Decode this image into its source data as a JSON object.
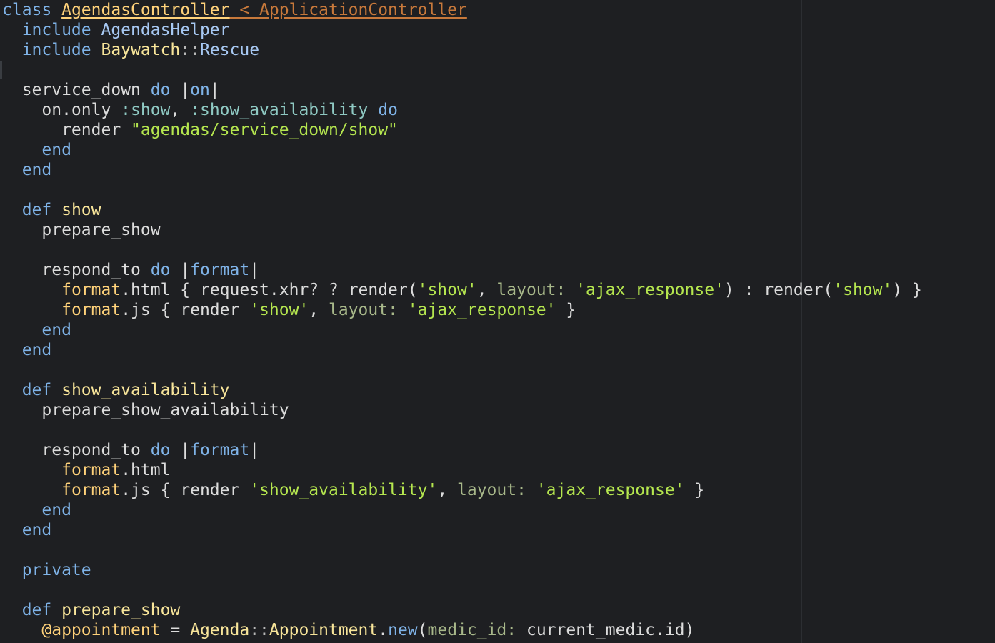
{
  "editor": {
    "colors": {
      "background": "#1e1f22",
      "keyword": "#7fb3e8",
      "class_name": "#ffd27a",
      "superclass": "#c8793b",
      "module": "#a7c8f2",
      "constant": "#f8e59a",
      "string": "#b5e64f",
      "symbol": "#8fc9c3",
      "method_def": "#f8e59a",
      "hash_key": "#a8b88a",
      "plain": "#dcdcdc"
    },
    "lines": [
      [
        {
          "t": "class ",
          "c": "kw"
        },
        {
          "t": "AgendasController",
          "c": "cls"
        },
        {
          "t": " < ApplicationController",
          "c": "sup"
        }
      ],
      [
        {
          "t": "  include ",
          "c": "kw"
        },
        {
          "t": "AgendasHelper",
          "c": "mod"
        }
      ],
      [
        {
          "t": "  include ",
          "c": "kw"
        },
        {
          "t": "Baywatch",
          "c": "const"
        },
        {
          "t": "::",
          "c": "sep"
        },
        {
          "t": "Rescue",
          "c": "mod"
        }
      ],
      [],
      [
        {
          "t": "  service_down ",
          "c": "plain"
        },
        {
          "t": "do",
          "c": "kw"
        },
        {
          "t": " |",
          "c": "bar"
        },
        {
          "t": "on",
          "c": "blk"
        },
        {
          "t": "|",
          "c": "bar"
        }
      ],
      [
        {
          "t": "    on.only ",
          "c": "plain"
        },
        {
          "t": ":show",
          "c": "sym"
        },
        {
          "t": ", ",
          "c": "plain"
        },
        {
          "t": ":show_availability",
          "c": "sym"
        },
        {
          "t": " do",
          "c": "kw"
        }
      ],
      [
        {
          "t": "      render ",
          "c": "plain"
        },
        {
          "t": "\"agendas/service_down/show\"",
          "c": "str"
        }
      ],
      [
        {
          "t": "    end",
          "c": "kw"
        }
      ],
      [
        {
          "t": "  end",
          "c": "kw"
        }
      ],
      [],
      [
        {
          "t": "  def ",
          "c": "kw"
        },
        {
          "t": "show",
          "c": "def"
        }
      ],
      [
        {
          "t": "    prepare_show",
          "c": "plain"
        }
      ],
      [],
      [
        {
          "t": "    respond_to ",
          "c": "plain"
        },
        {
          "t": "do",
          "c": "kw"
        },
        {
          "t": " |",
          "c": "bar"
        },
        {
          "t": "format",
          "c": "blk"
        },
        {
          "t": "|",
          "c": "bar"
        }
      ],
      [
        {
          "t": "      ",
          "c": "plain"
        },
        {
          "t": "format",
          "c": "ivar"
        },
        {
          "t": ".html { request.xhr? ? render(",
          "c": "plain"
        },
        {
          "t": "'show'",
          "c": "str"
        },
        {
          "t": ", ",
          "c": "plain"
        },
        {
          "t": "layout:",
          "c": "key"
        },
        {
          "t": " ",
          "c": "plain"
        },
        {
          "t": "'ajax_response'",
          "c": "str"
        },
        {
          "t": ") : render(",
          "c": "plain"
        },
        {
          "t": "'show'",
          "c": "str"
        },
        {
          "t": ") }",
          "c": "plain"
        }
      ],
      [
        {
          "t": "      ",
          "c": "plain"
        },
        {
          "t": "format",
          "c": "ivar"
        },
        {
          "t": ".js { render ",
          "c": "plain"
        },
        {
          "t": "'show'",
          "c": "str"
        },
        {
          "t": ", ",
          "c": "plain"
        },
        {
          "t": "layout:",
          "c": "key"
        },
        {
          "t": " ",
          "c": "plain"
        },
        {
          "t": "'ajax_response'",
          "c": "str"
        },
        {
          "t": " }",
          "c": "plain"
        }
      ],
      [
        {
          "t": "    end",
          "c": "kw"
        }
      ],
      [
        {
          "t": "  end",
          "c": "kw"
        }
      ],
      [],
      [
        {
          "t": "  def ",
          "c": "kw"
        },
        {
          "t": "show_availability",
          "c": "def"
        }
      ],
      [
        {
          "t": "    prepare_show_availability",
          "c": "plain"
        }
      ],
      [],
      [
        {
          "t": "    respond_to ",
          "c": "plain"
        },
        {
          "t": "do",
          "c": "kw"
        },
        {
          "t": " |",
          "c": "bar"
        },
        {
          "t": "format",
          "c": "blk"
        },
        {
          "t": "|",
          "c": "bar"
        }
      ],
      [
        {
          "t": "      ",
          "c": "plain"
        },
        {
          "t": "format",
          "c": "ivar"
        },
        {
          "t": ".html",
          "c": "plain"
        }
      ],
      [
        {
          "t": "      ",
          "c": "plain"
        },
        {
          "t": "format",
          "c": "ivar"
        },
        {
          "t": ".js { render ",
          "c": "plain"
        },
        {
          "t": "'show_availability'",
          "c": "str"
        },
        {
          "t": ", ",
          "c": "plain"
        },
        {
          "t": "layout:",
          "c": "key"
        },
        {
          "t": " ",
          "c": "plain"
        },
        {
          "t": "'ajax_response'",
          "c": "str"
        },
        {
          "t": " }",
          "c": "plain"
        }
      ],
      [
        {
          "t": "    end",
          "c": "kw"
        }
      ],
      [
        {
          "t": "  end",
          "c": "kw"
        }
      ],
      [],
      [
        {
          "t": "  private",
          "c": "kw"
        }
      ],
      [],
      [
        {
          "t": "  def ",
          "c": "kw"
        },
        {
          "t": "prepare_show",
          "c": "def"
        }
      ],
      [
        {
          "t": "    ",
          "c": "plain"
        },
        {
          "t": "@appointment",
          "c": "ivar"
        },
        {
          "t": " = ",
          "c": "plain"
        },
        {
          "t": "Agenda",
          "c": "const"
        },
        {
          "t": "::",
          "c": "sep"
        },
        {
          "t": "Appointment",
          "c": "const"
        },
        {
          "t": ".",
          "c": "plain"
        },
        {
          "t": "new",
          "c": "call"
        },
        {
          "t": "(",
          "c": "plain"
        },
        {
          "t": "medic_id:",
          "c": "key"
        },
        {
          "t": " current_medic.id)",
          "c": "plain"
        }
      ]
    ]
  }
}
